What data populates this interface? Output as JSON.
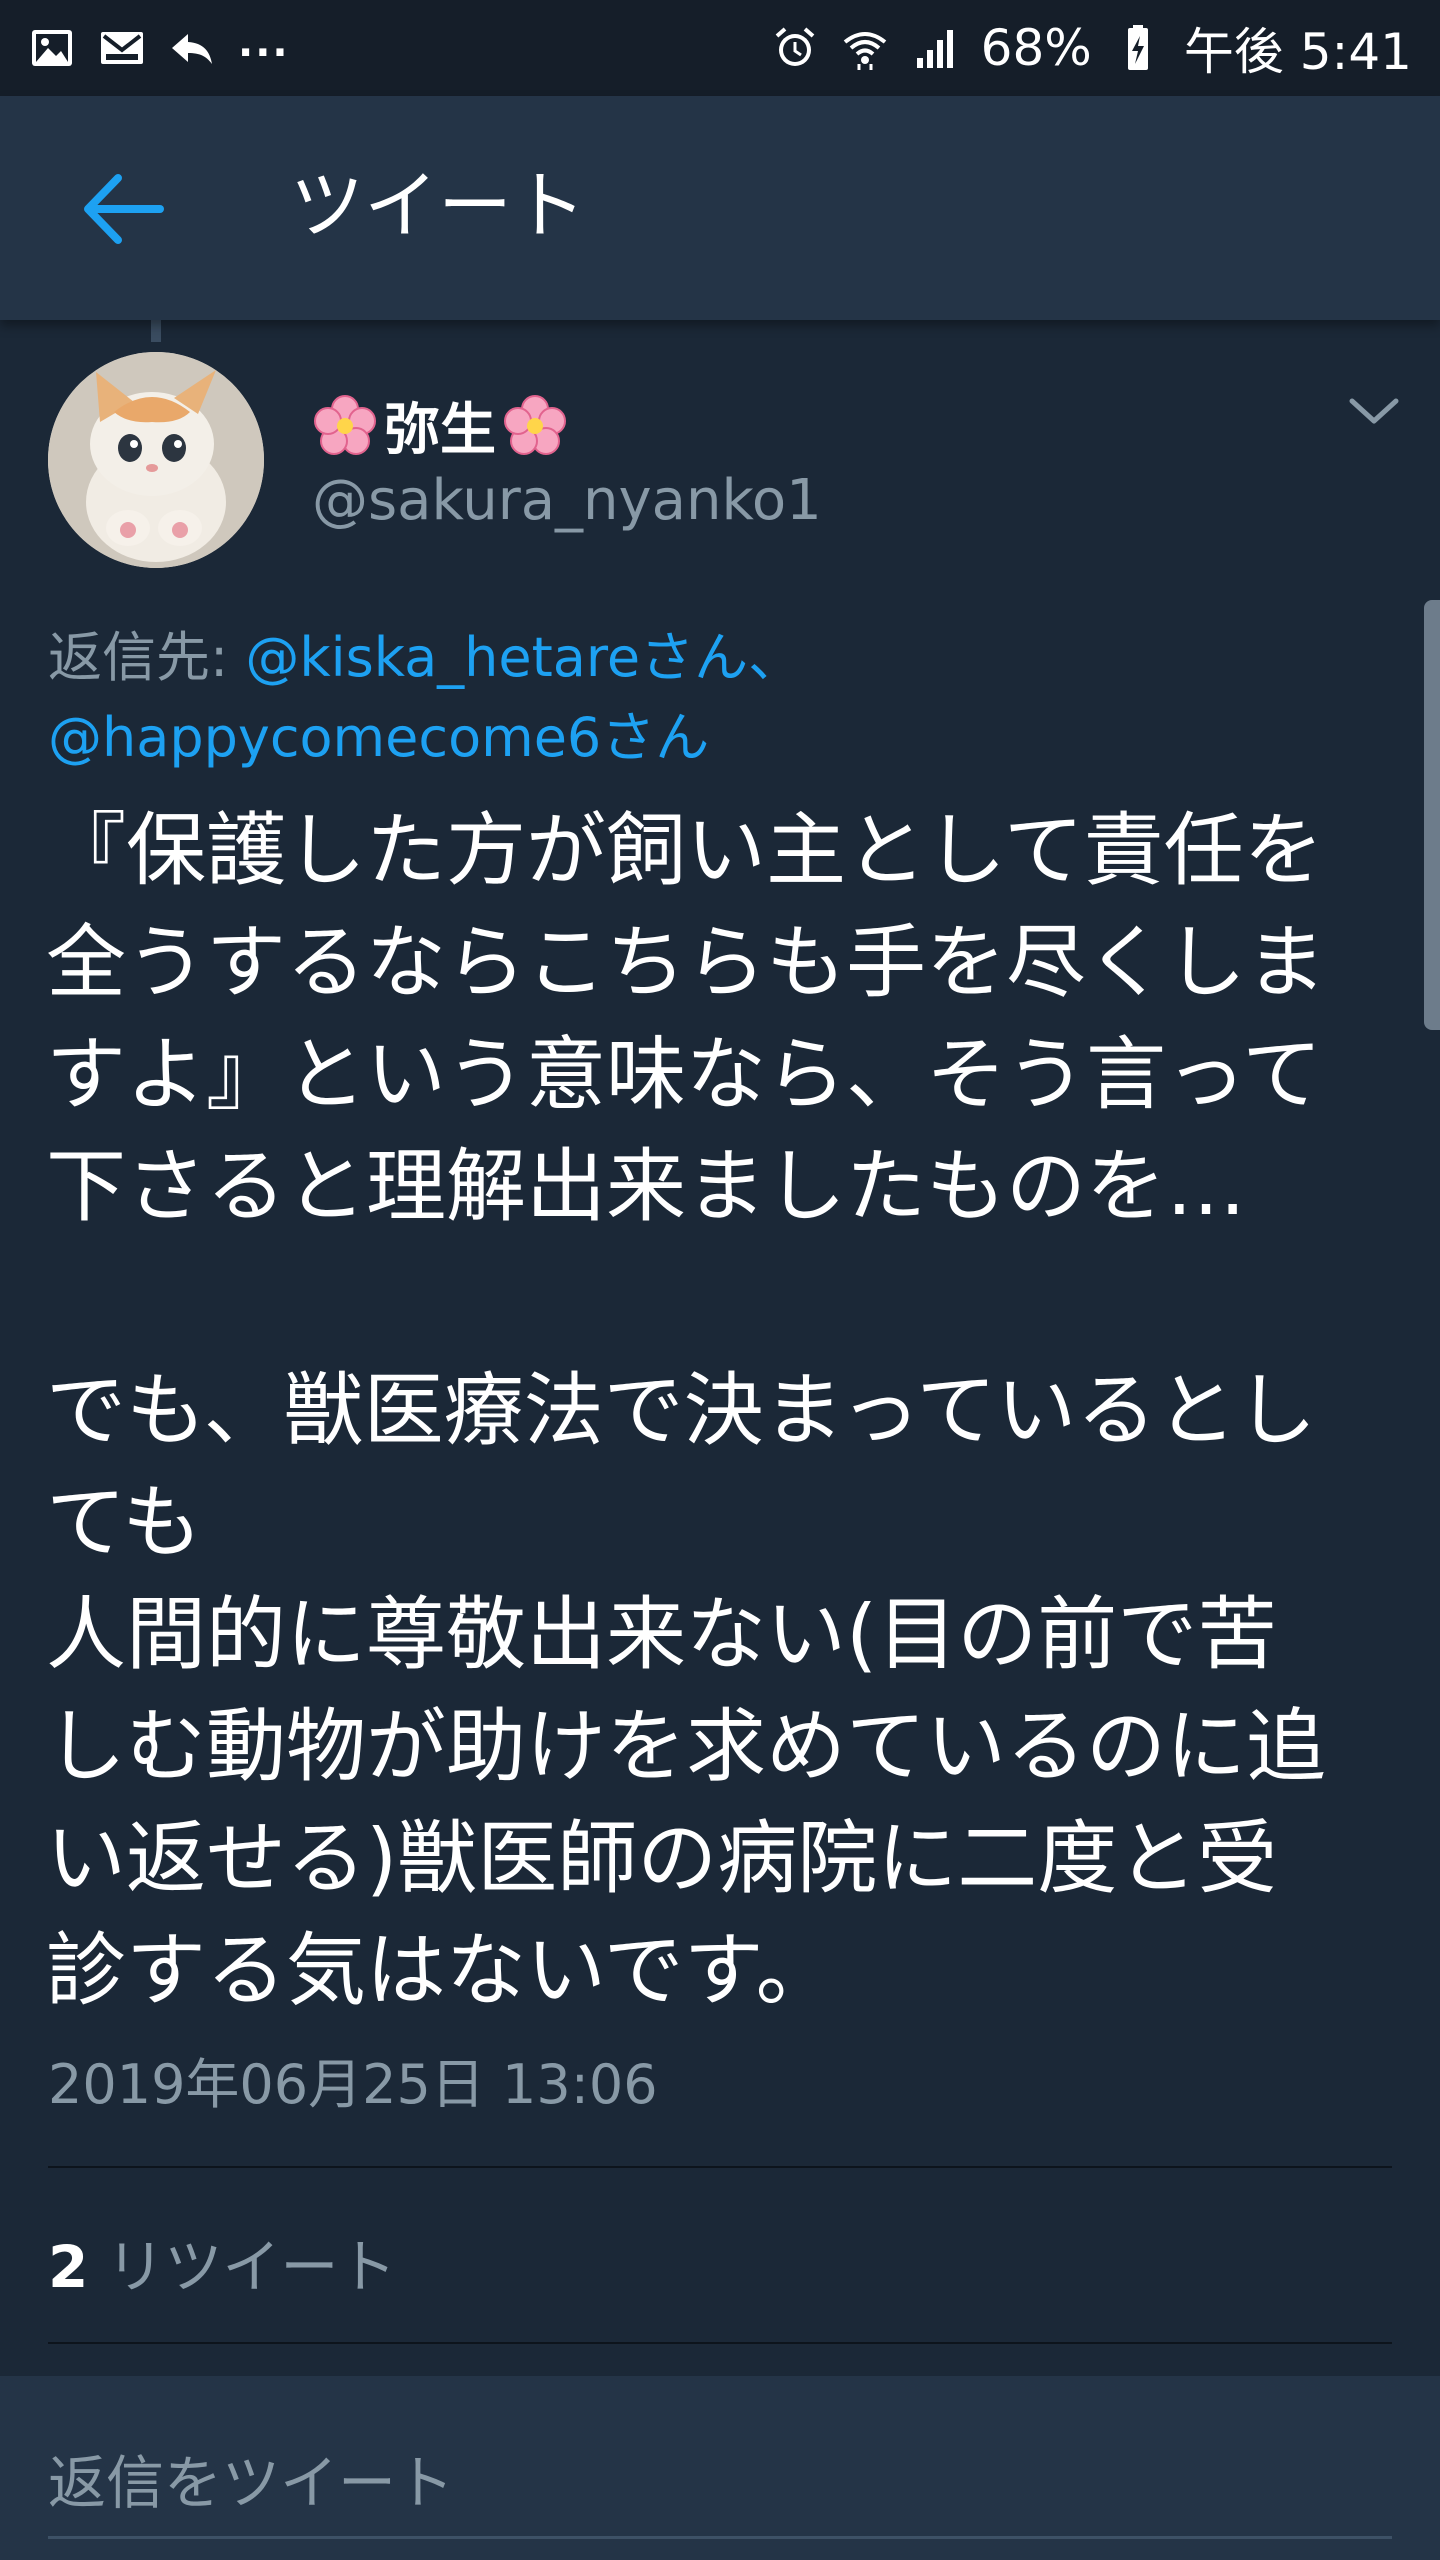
{
  "status_bar": {
    "icons_left": [
      "image-icon",
      "mail-icon",
      "reply-icon"
    ],
    "overflow": "...",
    "icons_right": [
      "alarm-icon",
      "wifi-icon",
      "signal-icon"
    ],
    "battery": "68%",
    "time": "午後 5:41"
  },
  "appbar": {
    "title": "ツイート"
  },
  "tweet": {
    "display_name": "弥生",
    "handle": "@sakura_nyanko1",
    "reply_to_label": "返信先: ",
    "reply_mention_1": "@kiska_hetareさん、",
    "reply_mention_2": "@happycomecome6さん",
    "body": "『保護した方が飼い主として責任を\n全うするならこちらも手を尽くしま\nすよ』という意味なら、そう言って\n下さると理解出来ましたものを…\n\nでも、獣医療法で決まっているとし\nても\n人間的に尊敬出来ない(目の前で苦\nしむ動物が助けを求めているのに追\nい返せる)獣医師の病院に二度と受\n診する気はないです。",
    "timestamp": "2019年06月25日 13:06",
    "retweet_count": "2",
    "retweet_label": "リツイート"
  },
  "reply_box": {
    "placeholder": "返信をツイート"
  },
  "colors": {
    "background": "#1b2837",
    "header": "#243447",
    "accent": "#1da1f2",
    "muted_text": "#8899a6"
  }
}
